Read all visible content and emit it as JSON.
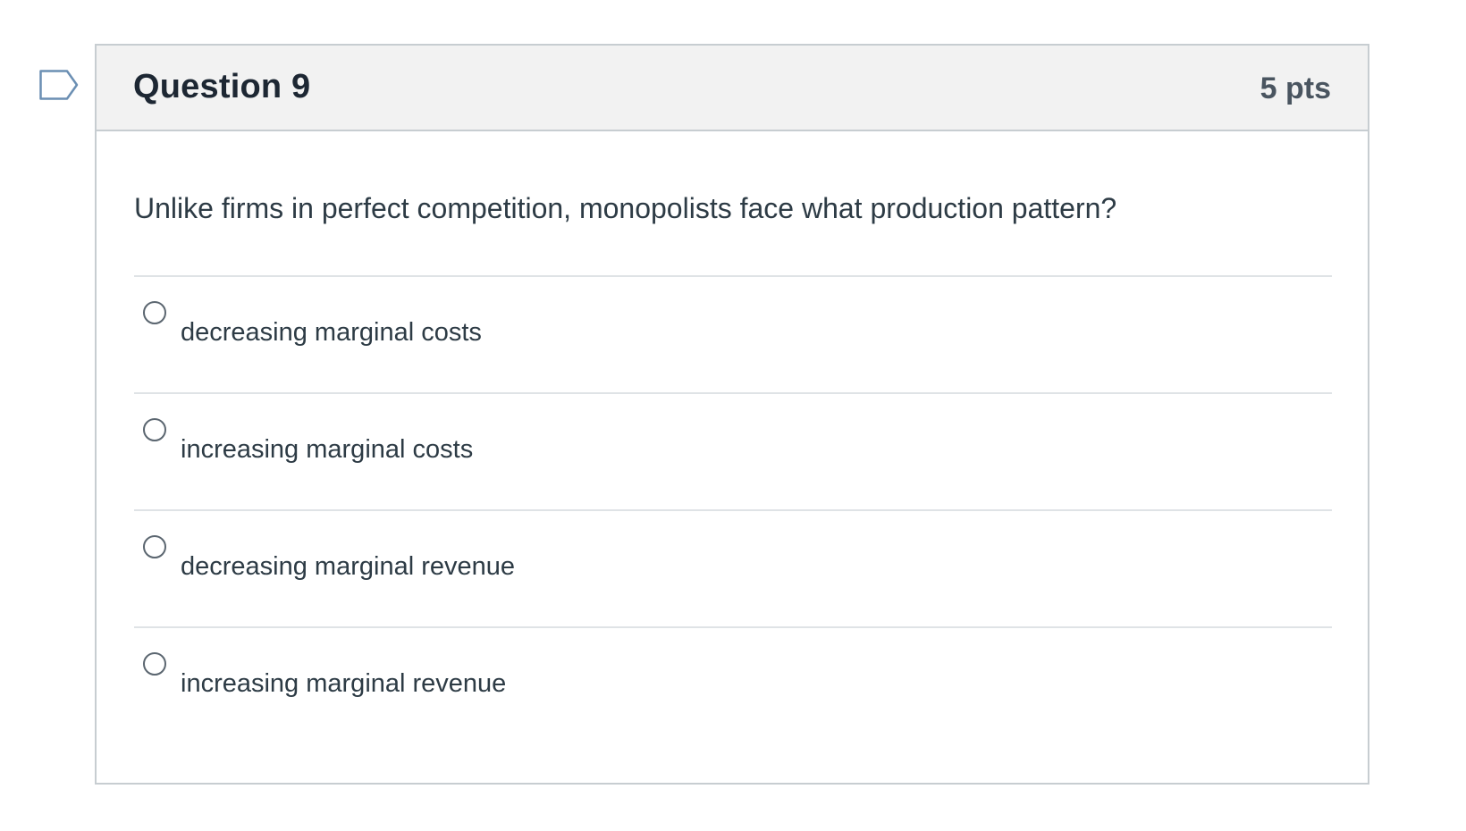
{
  "flag": {
    "icon": "flag-question-icon"
  },
  "question": {
    "title": "Question 9",
    "points": "5 pts",
    "text": "Unlike firms in perfect competition, monopolists face what production pattern?",
    "answers": [
      {
        "label": "decreasing marginal costs",
        "selected": false
      },
      {
        "label": "increasing marginal costs",
        "selected": false
      },
      {
        "label": "decreasing marginal revenue",
        "selected": false
      },
      {
        "label": "increasing marginal revenue",
        "selected": false
      }
    ]
  },
  "colors": {
    "header_bg": "#f2f2f2",
    "border": "#c7cdd1",
    "divider": "#dfe3e6",
    "title_text": "#1d2733",
    "body_text": "#2d3b45",
    "flag_stroke": "#6b8fb3"
  }
}
